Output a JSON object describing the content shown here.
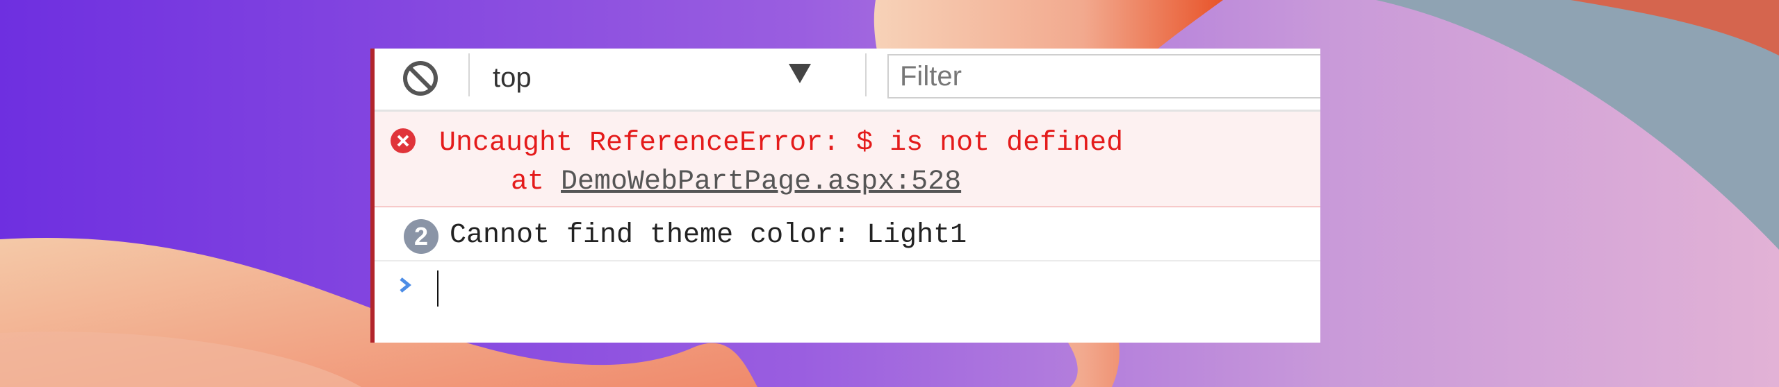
{
  "toolbar": {
    "context_label": "top",
    "filter_placeholder": "Filter"
  },
  "messages": [
    {
      "level": "error",
      "text": "Uncaught ReferenceError: $ is not defined",
      "at_prefix": "at ",
      "source_link": "DemoWebPartPage.aspx:528"
    },
    {
      "level": "warning",
      "repeat_count": "2",
      "text": "Cannot find theme color: Light1"
    }
  ],
  "prompt": {
    "value": ""
  },
  "colors": {
    "error_text": "#e41b1b",
    "error_background": "#fdf1f1",
    "badge": "#8a94a6",
    "prompt_arrow": "#4d8de6"
  },
  "icons": {
    "clear": "block-icon",
    "error": "error-circle-icon",
    "prompt": "chevron-right-icon",
    "dropdown": "triangle-down-icon"
  }
}
